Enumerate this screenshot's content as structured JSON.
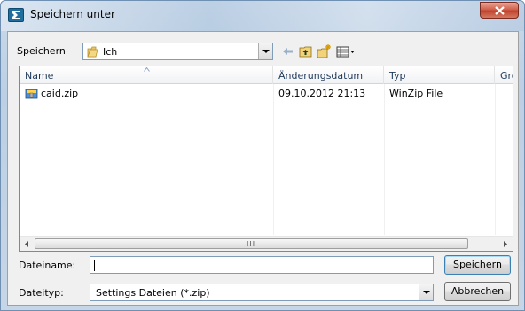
{
  "window": {
    "title": "Speichern unter"
  },
  "toolbar": {
    "save_in_label": "Speichern",
    "current_folder": "Ich",
    "icons": [
      "back-arrow-icon",
      "up-folder-icon",
      "new-folder-icon",
      "view-menu-icon"
    ]
  },
  "list": {
    "columns": [
      "Name",
      "Änderungsdatum",
      "Typ",
      "Größ"
    ],
    "rows": [
      {
        "name": "caid.zip",
        "date": "09.10.2012 21:13",
        "type": "WinZip File"
      }
    ]
  },
  "bottom": {
    "filename_label": "Dateiname:",
    "filename_value": "",
    "filetype_label": "Dateityp:",
    "filetype_value": "Settings Dateien (*.zip)",
    "save_button": "Speichern",
    "cancel_button": "Abbrechen"
  },
  "colors": {
    "close_button": "#c0442c",
    "header_text": "#1e395b"
  }
}
